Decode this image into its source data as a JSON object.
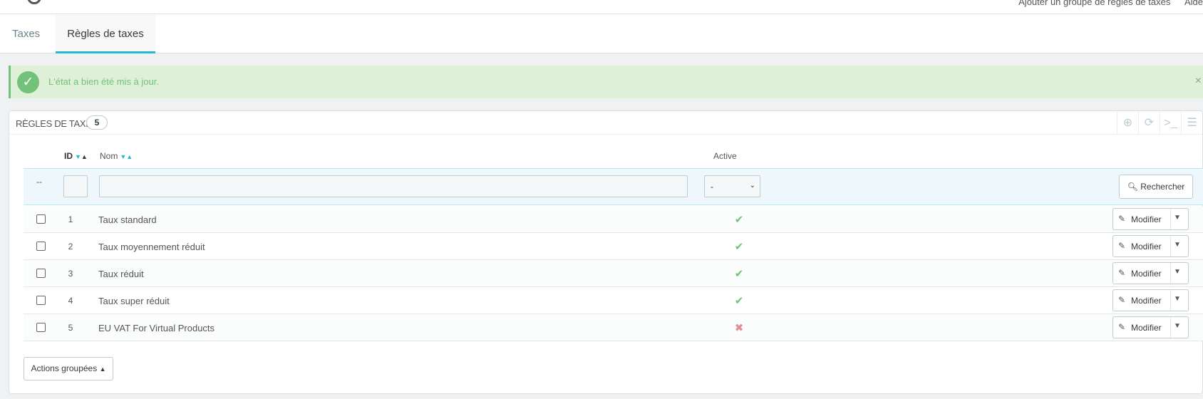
{
  "header": {
    "add_link": "Ajouter un groupe de règles de taxes",
    "help_link": "Aide"
  },
  "tabs": [
    {
      "label": "Taxes"
    },
    {
      "label": "Règles de taxes"
    }
  ],
  "alert": {
    "message": "L'état a bien été mis à jour.",
    "close": "×"
  },
  "panel": {
    "title": "Règles de taxes",
    "count": "5"
  },
  "table": {
    "columns": {
      "id": "ID",
      "name": "Nom",
      "active": "Active"
    },
    "filter": {
      "dash": "--",
      "active_selected": "-",
      "search_label": "Rechercher"
    },
    "rows": [
      {
        "id": "1",
        "name": "Taux standard",
        "active": true
      },
      {
        "id": "2",
        "name": "Taux moyennement réduit",
        "active": true
      },
      {
        "id": "3",
        "name": "Taux réduit",
        "active": true
      },
      {
        "id": "4",
        "name": "Taux super réduit",
        "active": true
      },
      {
        "id": "5",
        "name": "EU VAT For Virtual Products",
        "active": false
      }
    ],
    "edit_label": "Modifier"
  },
  "bulk_actions": "Actions groupées",
  "colors": {
    "accent": "#25b9d7",
    "success": "#72c279",
    "danger": "#e08f95"
  }
}
